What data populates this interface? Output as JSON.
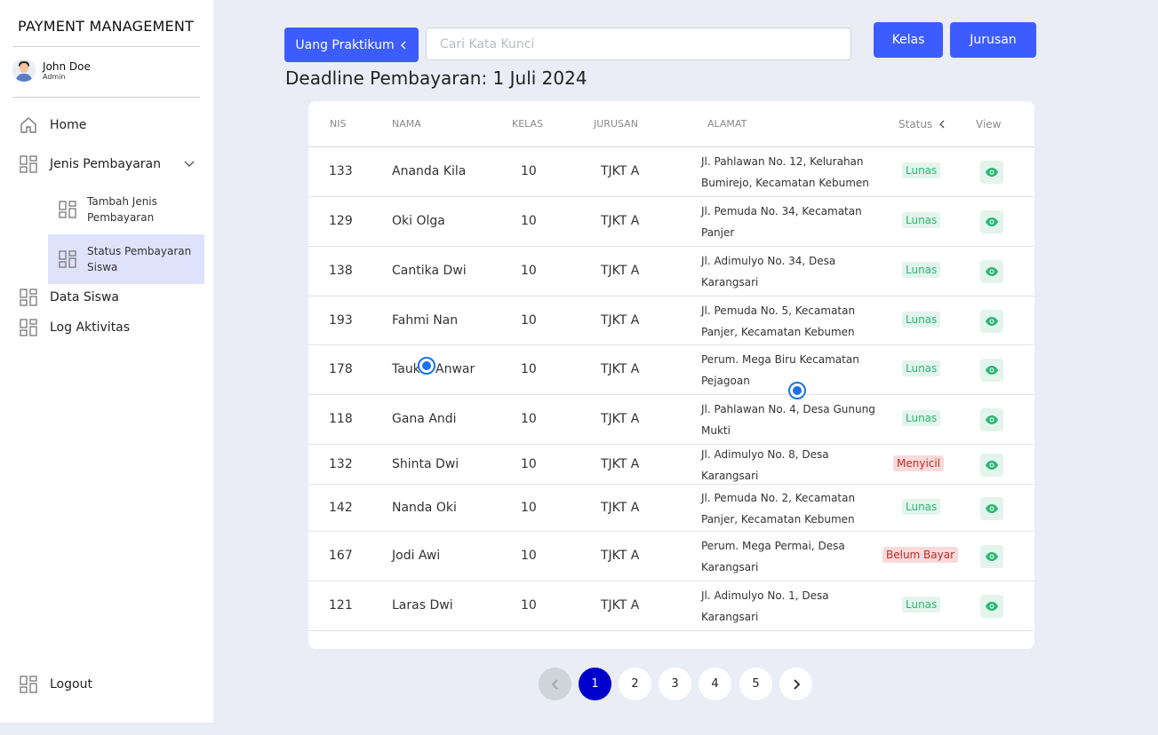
{
  "app": {
    "title": "PAYMENT MANAGEMENT"
  },
  "user": {
    "name": "John Doe",
    "role": "Admin"
  },
  "sidebar": {
    "home": "Home",
    "jenis_pembayaran": "Jenis Pembayaran",
    "tambah_jenis": "Tambah Jenis Pembayaran",
    "status_pembayaran": "Status Pembayaran Siswa",
    "data_siswa": "Data Siswa",
    "log_aktivitas": "Log Aktivitas",
    "logout": "Logout"
  },
  "toolbar": {
    "dropdown_label": "Uang Praktikum",
    "search_placeholder": "Cari Kata Kunci",
    "kelas_label": "Kelas",
    "jurusan_label": "Jurusan"
  },
  "deadline": "Deadline Pembayaran: 1 Juli 2024",
  "table": {
    "headers": {
      "nis": "NIS",
      "nama": "NAMA",
      "kelas": "KELAS",
      "jurusan": "JURUSAN",
      "alamat": "ALAMAT",
      "status": "Status",
      "view": "View"
    },
    "rows": [
      {
        "nis": "133",
        "nama": "Ananda Kila",
        "kelas": "10",
        "jurusan": "TJKT A",
        "alamat": "Jl. Pahlawan No. 12, Kelurahan Bumirejo, Kecamatan Kebumen",
        "status": "Lunas"
      },
      {
        "nis": "129",
        "nama": "Oki Olga",
        "kelas": "10",
        "jurusan": "TJKT A",
        "alamat": "Jl. Pemuda No. 34,  Kecamatan Panjer",
        "status": "Lunas"
      },
      {
        "nis": "138",
        "nama": "Cantika Dwi",
        "kelas": "10",
        "jurusan": "TJKT A",
        "alamat": "Jl. Adimulyo No. 34, Desa Karangsari",
        "status": "Lunas"
      },
      {
        "nis": "193",
        "nama": "Fahmi Nan",
        "kelas": "10",
        "jurusan": "TJKT A",
        "alamat": "Jl. Pemuda No. 5, Kecamatan Panjer, Kecamatan Kebumen",
        "status": "Lunas"
      },
      {
        "nis": "178",
        "nama": "Taukid Anwar",
        "kelas": "10",
        "jurusan": "TJKT A",
        "alamat": "Perum. Mega Biru Kecamatan Pejagoan",
        "status": "Lunas"
      },
      {
        "nis": "118",
        "nama": "Gana Andi",
        "kelas": "10",
        "jurusan": "TJKT A",
        "alamat": "Jl. Pahlawan No. 4, Desa Gunung Mukti",
        "status": "Lunas"
      },
      {
        "nis": "132",
        "nama": "Shinta Dwi",
        "kelas": "10",
        "jurusan": "TJKT A",
        "alamat": "Jl. Adimulyo No. 8, Desa Karangsari",
        "status": "Menyicil"
      },
      {
        "nis": "142",
        "nama": "Nanda Oki",
        "kelas": "10",
        "jurusan": "TJKT A",
        "alamat": "Jl. Pemuda No. 2, Kecamatan Panjer, Kecamatan Kebumen",
        "status": "Lunas"
      },
      {
        "nis": "167",
        "nama": "Jodi Awi",
        "kelas": "10",
        "jurusan": "TJKT A",
        "alamat": "Perum. Mega Permai, Desa Karangsari",
        "status": "Belum Bayar"
      },
      {
        "nis": "121",
        "nama": "Laras Dwi",
        "kelas": "10",
        "jurusan": "TJKT A",
        "alamat": "Jl. Adimulyo No. 1, Desa Karangsari",
        "status": "Lunas"
      }
    ]
  },
  "pagination": {
    "pages": [
      "1",
      "2",
      "3",
      "4",
      "5"
    ],
    "current": "1"
  },
  "colors": {
    "accent": "#3d5cff",
    "lunas": "#2bb673",
    "unpaid": "#c62828",
    "active_page": "#0000cc"
  },
  "icons": {
    "nav": "grid-icon",
    "home": "home-icon",
    "view": "eye-icon"
  }
}
